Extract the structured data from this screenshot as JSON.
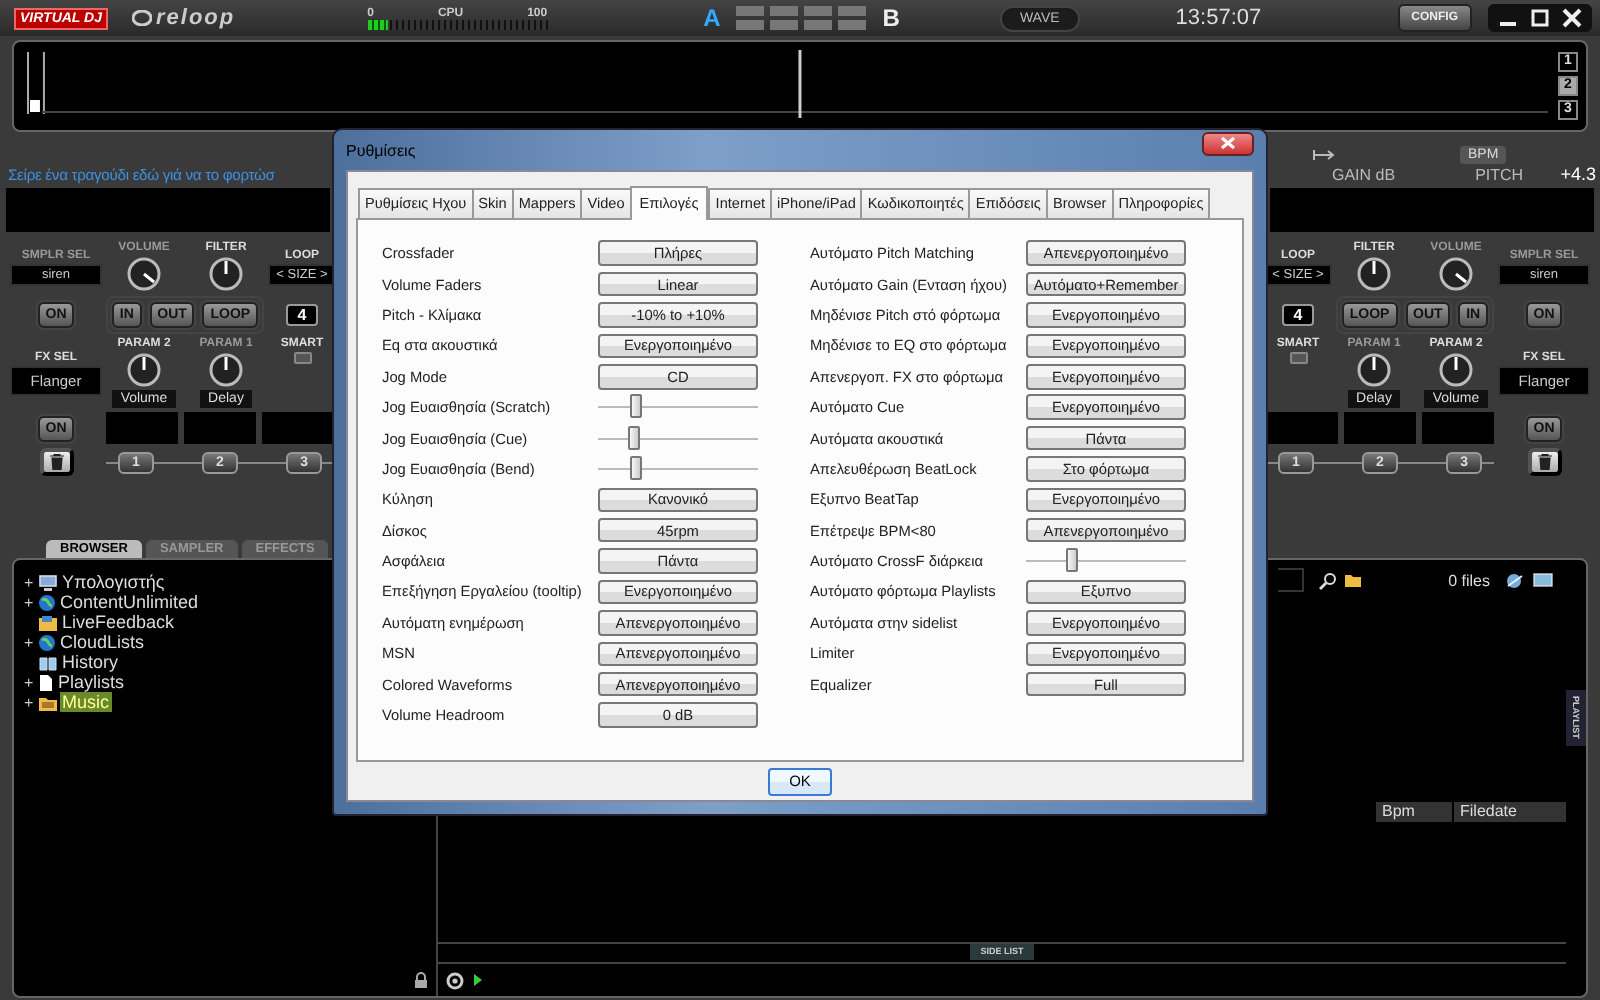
{
  "topbar": {
    "logo": "VIRTUAL DJ",
    "brand": "reloop",
    "cpu": {
      "min": "0",
      "label": "CPU",
      "max": "100",
      "level": 0.12
    },
    "deck_a": "A",
    "deck_b": "B",
    "view_button": "WAVE",
    "clock": "13:57:07",
    "config_button": "CONFIG"
  },
  "waveform": {
    "pages": [
      {
        "label": "1",
        "selected": false
      },
      {
        "label": "2",
        "selected": true
      },
      {
        "label": "3",
        "selected": false
      }
    ]
  },
  "decks": [
    {
      "hint": "Σείρε ένα τραγούδι εδώ γιά να το φορτώσ",
      "sampler": {
        "label": "SMPLR SEL",
        "value": "siren",
        "on_button": "ON"
      },
      "volume": {
        "label": "VOLUME"
      },
      "filter": {
        "label": "FILTER"
      },
      "loop": {
        "label": "LOOP",
        "size": "< SIZE >",
        "length": "4"
      },
      "loop_buttons": [
        "IN",
        "OUT",
        "LOOP"
      ],
      "smart": {
        "label": "SMART",
        "on": false
      },
      "fx": {
        "label": "FX SEL",
        "value": "Flanger",
        "on_button": "ON"
      },
      "params": [
        {
          "label": "PARAM 2",
          "value": "Volume",
          "active": true
        },
        {
          "label": "PARAM 1",
          "value": "Delay",
          "active": false
        }
      ],
      "hotcues": [
        "1",
        "2",
        "3"
      ]
    },
    {
      "header": {
        "bpm": "BPM",
        "gain": "GAIN dB",
        "pitch_label": "PITCH",
        "pitch": "+4.3"
      },
      "sampler": {
        "label": "SMPLR SEL",
        "value": "siren",
        "on_button": "ON"
      },
      "volume": {
        "label": "VOLUME"
      },
      "filter": {
        "label": "FILTER"
      },
      "loop": {
        "label": "LOOP",
        "size": "< SIZE >",
        "length": "4"
      },
      "loop_buttons": [
        "LOOP",
        "OUT",
        "IN"
      ],
      "smart": {
        "label": "SMART",
        "on": false
      },
      "fx": {
        "label": "FX SEL",
        "value": "Flanger",
        "on_button": "ON"
      },
      "params": [
        {
          "label": "PARAM 1",
          "value": "Delay",
          "active": false
        },
        {
          "label": "PARAM 2",
          "value": "Volume",
          "active": true
        }
      ],
      "hotcues": [
        "1",
        "2",
        "3"
      ]
    }
  ],
  "browser": {
    "tabs": [
      {
        "label": "BROWSER",
        "selected": true
      },
      {
        "label": "SAMPLER",
        "selected": false
      },
      {
        "label": "EFFECTS",
        "selected": false
      }
    ],
    "tree": [
      {
        "toggle": "+",
        "label": "Υπολογιστής",
        "kind": "computer",
        "selected": false
      },
      {
        "toggle": "+",
        "label": "ContentUnlimited",
        "kind": "globe",
        "selected": false
      },
      {
        "label": "LiveFeedback",
        "kind": "feed",
        "selected": false
      },
      {
        "toggle": "+",
        "label": "CloudLists",
        "kind": "globe",
        "selected": false
      },
      {
        "label": "History",
        "kind": "book",
        "selected": false
      },
      {
        "toggle": "+",
        "label": "Playlists",
        "kind": "file",
        "selected": false
      },
      {
        "toggle": "+",
        "label": "Music",
        "kind": "folder",
        "selected": true
      }
    ],
    "file_count": "0 files",
    "columns": [
      "Bpm",
      "Filedate"
    ],
    "side_list": "SIDE LIST",
    "playlist_tab": "PLAYLIST"
  },
  "dialog": {
    "title": "Ρυθμίσεις",
    "tabs": [
      {
        "label": "Ρυθμίσεις Ηχου",
        "selected": false
      },
      {
        "label": "Skin",
        "selected": false
      },
      {
        "label": "Mappers",
        "selected": false
      },
      {
        "label": "Video",
        "selected": false
      },
      {
        "label": "Επιλογές",
        "selected": true
      },
      {
        "label": "Internet",
        "selected": false
      },
      {
        "label": "iPhone/iPad",
        "selected": false
      },
      {
        "label": "Κωδικοποιητές",
        "selected": false
      },
      {
        "label": "Επιδόσεις",
        "selected": false
      },
      {
        "label": "Browser",
        "selected": false
      },
      {
        "label": "Πληροφορίες",
        "selected": false
      }
    ],
    "left": [
      {
        "kind": "button",
        "label": "Crossfader",
        "value": "Πλήρες"
      },
      {
        "kind": "button",
        "label": "Volume Faders",
        "value": "Linear"
      },
      {
        "kind": "button",
        "label": "Pitch - Κλίμακα",
        "value": "-10% to +10%"
      },
      {
        "kind": "button",
        "label": "Eq στα ακουστικά",
        "value": "Ενεργοποιημένο"
      },
      {
        "kind": "button",
        "label": "Jog Mode",
        "value": "CD"
      },
      {
        "kind": "slider",
        "label": "Jog Ευαισθησία (Scratch)",
        "level": 0.22
      },
      {
        "kind": "slider",
        "label": "Jog Ευαισθησία (Cue)",
        "level": 0.2
      },
      {
        "kind": "slider",
        "label": "Jog Ευαισθησία (Bend)",
        "level": 0.21
      },
      {
        "kind": "button",
        "label": "Κύληση",
        "value": "Κανονικό"
      },
      {
        "kind": "button",
        "label": "Δίσκος",
        "value": "45rpm"
      },
      {
        "kind": "button",
        "label": "Ασφάλεια",
        "value": "Πάντα"
      },
      {
        "kind": "button",
        "label": "Επεξήγηση Εργαλείου (tooltip)",
        "value": "Ενεργοποιημένο"
      },
      {
        "kind": "button",
        "label": "Αυτόματη ενημέρωση",
        "value": "Απενεργοποιημένο"
      },
      {
        "kind": "button",
        "label": "MSN",
        "value": "Απενεργοποιημένο"
      },
      {
        "kind": "button",
        "label": "Colored Waveforms",
        "value": "Απενεργοποιημένο"
      },
      {
        "kind": "button",
        "label": "Volume Headroom",
        "value": "0 dB"
      }
    ],
    "right": [
      {
        "kind": "button",
        "label": "Αυτόματο Pitch Matching",
        "value": "Απενεργοποιημένο"
      },
      {
        "kind": "button",
        "label": "Αυτόματο Gain (Ενταση ήχου)",
        "value": "Αυτόματο+Remember"
      },
      {
        "kind": "button",
        "label": "Μηδένισε Pitch στό φόρτωμα",
        "value": "Ενεργοποιημένο"
      },
      {
        "kind": "button",
        "label": "Μηδένισε το EQ στο φόρτωμα",
        "value": "Ενεργοποιημένο"
      },
      {
        "kind": "button",
        "label": "Απενεργοπ. FX στο φόρτωμα",
        "value": "Ενεργοποιημένο"
      },
      {
        "kind": "button",
        "label": "Αυτόματο Cue",
        "value": "Ενεργοποιημένο"
      },
      {
        "kind": "button",
        "label": "Αυτόματα ακουστικά",
        "value": "Πάντα"
      },
      {
        "kind": "button",
        "label": "Απελευθέρωση BeatLock",
        "value": "Στο φόρτωμα"
      },
      {
        "kind": "button",
        "label": "Εξυπνο BeatTap",
        "value": "Ενεργοποιημένο"
      },
      {
        "kind": "button",
        "label": "Επέτρεψε BPM<80",
        "value": "Απενεργοποιημένο"
      },
      {
        "kind": "slider",
        "label": "Αυτόματο CrossF διάρκεια",
        "level": 0.27
      },
      {
        "kind": "button",
        "label": "Αυτόματο φόρτωμα Playlists",
        "value": "Εξυπνο"
      },
      {
        "kind": "button",
        "label": "Αυτόματα στην sidelist",
        "value": "Ενεργοποιημένο"
      },
      {
        "kind": "button",
        "label": "Limiter",
        "value": "Ενεργοποιημένο"
      },
      {
        "kind": "button",
        "label": "Equalizer",
        "value": "Full"
      }
    ],
    "ok_button": "OK"
  }
}
